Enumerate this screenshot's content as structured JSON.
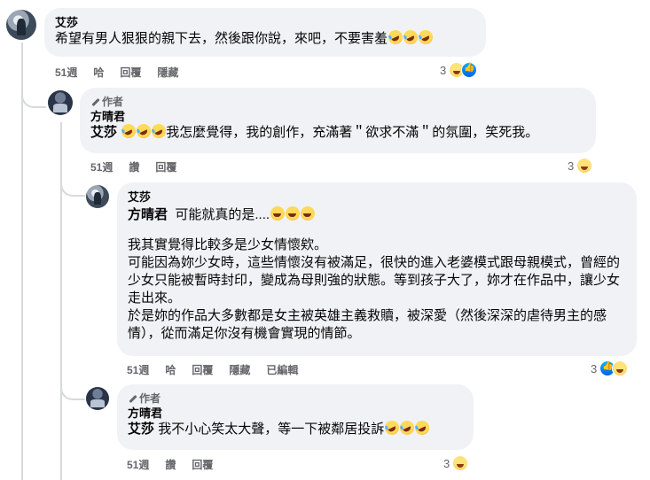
{
  "comments": [
    {
      "author": "艾莎",
      "text": "希望有男人狠狠的親下去，然後跟你說，來吧，不要害羞",
      "emoji_after": "rofl x3",
      "time": "51週",
      "actions": [
        "哈",
        "回覆",
        "隱藏"
      ],
      "reaction_count": "3",
      "reactions": [
        "haha-icon",
        "like-icon"
      ]
    },
    {
      "badge": "作者",
      "author": "方晴君",
      "mention": "艾莎",
      "text": "我怎麼覺得，我的創作，充滿著＂欲求不滿＂的氛圍，笑死我。",
      "time": "51週",
      "actions": [
        "讚",
        "回覆"
      ],
      "reaction_count": "3",
      "reactions": [
        "haha-icon"
      ]
    },
    {
      "author": "艾莎",
      "mention": "方晴君",
      "first_line": "可能就真的是....",
      "paragraphs": [
        "我其實覺得比較多是少女情懷欸。",
        "可能因為妳少女時，這些情懷沒有被滿足，很快的進入老婆模式跟母親模式，曾經的少女只能被暫時封印，變成為母則強的狀態。等到孩子大了，妳才在作品中，讓少女走出來。",
        "於是妳的作品大多數都是女主被英雄主義救贖，被深愛（然後深深的虐待男主的感情），從而滿足你沒有機會實現的情節。"
      ],
      "time": "51週",
      "actions": [
        "哈",
        "回覆",
        "隱藏",
        "已編輯"
      ],
      "reaction_count": "3",
      "reactions": [
        "like-icon",
        "haha-icon"
      ]
    },
    {
      "badge": "作者",
      "author": "方晴君",
      "mention": "艾莎",
      "text": "我不小心笑太大聲，等一下被鄰居投訴",
      "time": "51週",
      "actions": [
        "讚",
        "回覆"
      ],
      "reaction_count": "3",
      "reactions": [
        "haha-icon"
      ]
    }
  ]
}
